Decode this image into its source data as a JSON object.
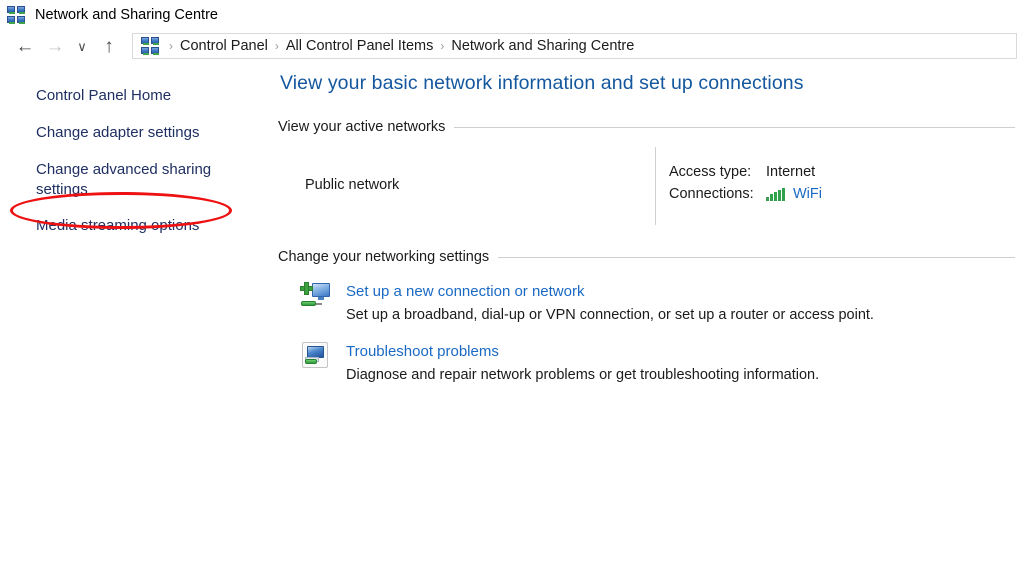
{
  "window": {
    "title": "Network and Sharing Centre",
    "icon": "network-icon"
  },
  "nav": {
    "back": "←",
    "forward": "→",
    "recent": "∨",
    "up": "↑",
    "back_name": "back-button",
    "forward_name": "forward-button"
  },
  "breadcrumb": {
    "separator": "›",
    "items": [
      {
        "label": "Control Panel"
      },
      {
        "label": "All Control Panel Items"
      },
      {
        "label": "Network and Sharing Centre"
      }
    ]
  },
  "sidebar": {
    "items": [
      {
        "label": "Control Panel Home"
      },
      {
        "label": "Change adapter settings"
      },
      {
        "label": "Change advanced sharing settings"
      },
      {
        "label": "Media streaming options"
      }
    ]
  },
  "annotation": {
    "shape": "ellipse",
    "color": "#ee1111",
    "targets": "Change adapter settings"
  },
  "main": {
    "heading": "View your basic network information and set up connections",
    "active_networks": {
      "section_title": "View your active networks",
      "network_name": "Public network",
      "details": [
        {
          "key": "Access type:",
          "value": "Internet",
          "is_link": false
        },
        {
          "key": "Connections:",
          "value": "WiFi",
          "is_link": true,
          "icon": "wifi-signal-icon"
        }
      ]
    },
    "settings": {
      "section_title": "Change your networking settings",
      "tasks": [
        {
          "icon": "new-connection-icon",
          "title": "Set up a new connection or network",
          "description": "Set up a broadband, dial-up or VPN connection, or set up a router or access point."
        },
        {
          "icon": "troubleshoot-icon",
          "title": "Troubleshoot problems",
          "description": "Diagnose and repair network problems or get troubleshooting information."
        }
      ]
    }
  },
  "colors": {
    "heading_blue": "#14579e",
    "link_blue": "#1a69c4",
    "sidebar_navy": "#1f2f62",
    "annotation_red": "#ee1111",
    "signal_green": "#2fa24a"
  }
}
